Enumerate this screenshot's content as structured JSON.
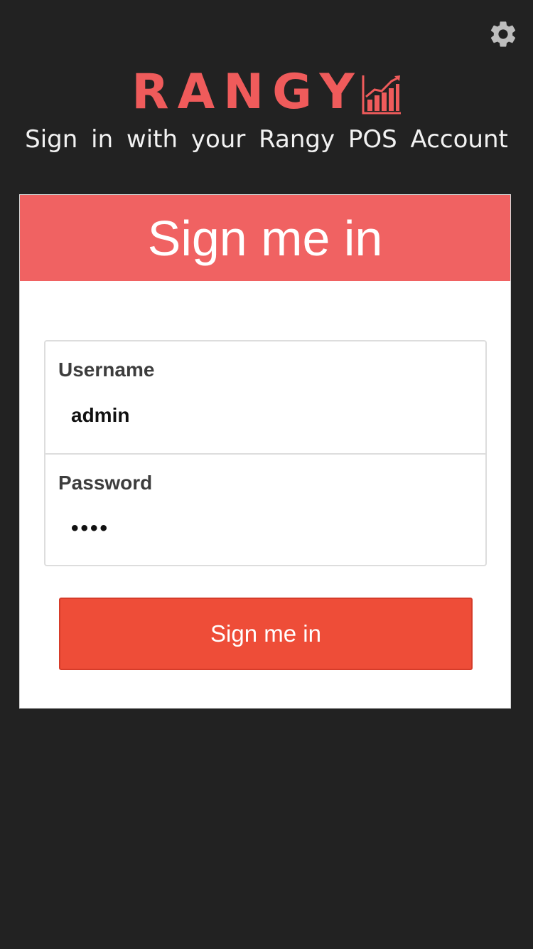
{
  "header": {
    "settings_icon": "gear-icon",
    "logo_text": "RANGY",
    "logo_icon": "bar-chart-icon",
    "subtitle": "Sign in with your Rangy POS Account"
  },
  "card": {
    "title": "Sign me in",
    "username": {
      "label": "Username",
      "value": "admin"
    },
    "password": {
      "label": "Password",
      "value": "••••"
    },
    "submit_label": "Sign me in"
  },
  "colors": {
    "background": "#222222",
    "brand": "#ef5b5b",
    "header_bar": "#f06262",
    "button": "#ee4d38",
    "icon_gray": "#bdbdbd"
  }
}
